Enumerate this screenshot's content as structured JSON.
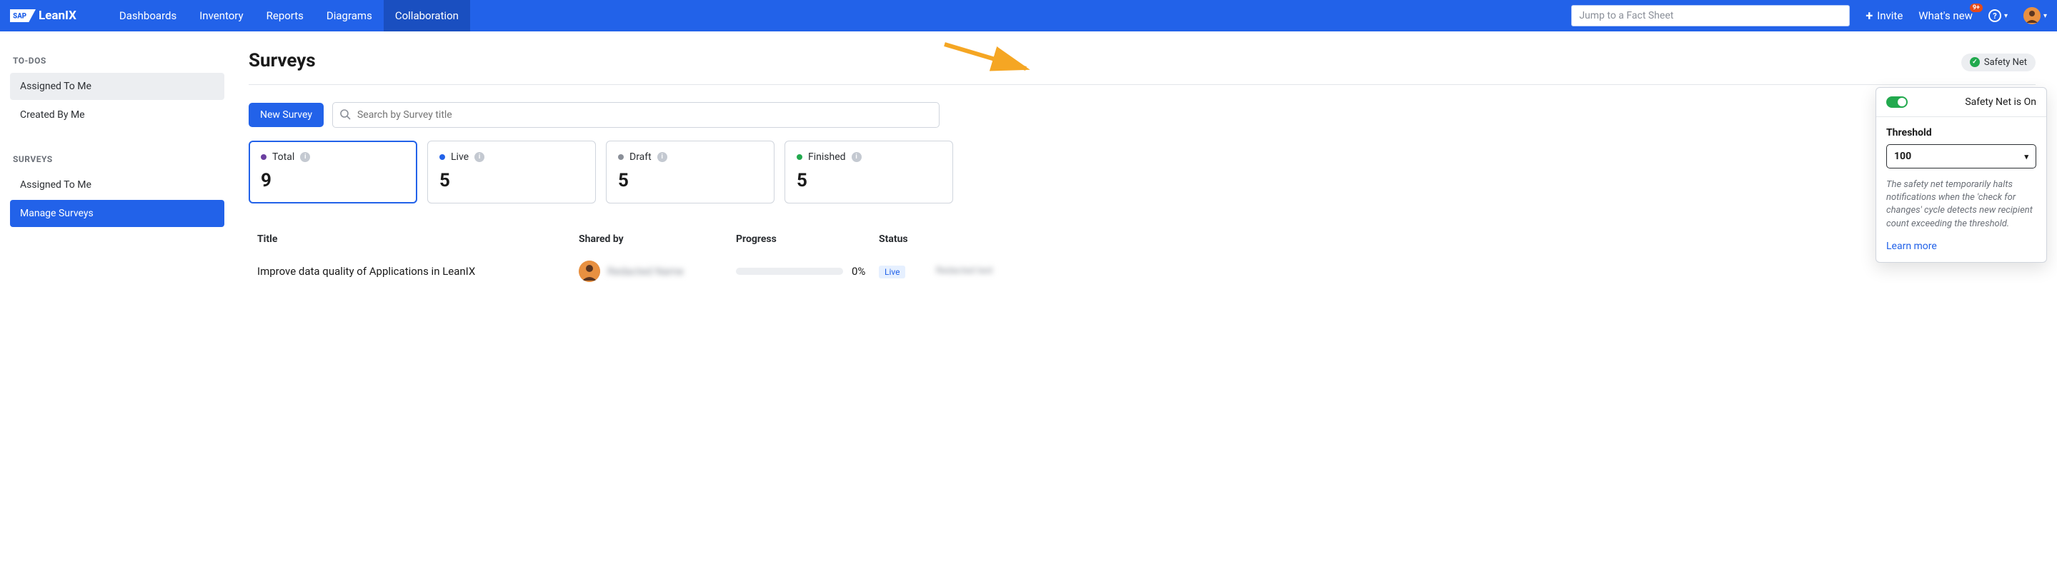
{
  "topbar": {
    "brand_prefix": "SAP",
    "brand_name": "LeanIX",
    "nav": [
      "Dashboards",
      "Inventory",
      "Reports",
      "Diagrams",
      "Collaboration"
    ],
    "active_nav_index": 4,
    "jump_placeholder": "Jump to a Fact Sheet",
    "invite": "Invite",
    "whats_new": "What's new",
    "whats_new_badge": "9+"
  },
  "sidebar": {
    "todos_header": "TO-DOS",
    "todos": [
      "Assigned To Me",
      "Created By Me"
    ],
    "surveys_header": "SURVEYS",
    "surveys": [
      "Assigned To Me",
      "Manage Surveys"
    ],
    "selected_todo_index": 0,
    "active_survey_index": 1
  },
  "page": {
    "title": "Surveys",
    "safety_chip": "Safety Net",
    "new_survey": "New Survey",
    "search_placeholder": "Search by Survey title"
  },
  "stats": [
    {
      "label": "Total",
      "value": "9",
      "dot": "#6b3fa0"
    },
    {
      "label": "Live",
      "value": "5",
      "dot": "#2262e9"
    },
    {
      "label": "Draft",
      "value": "5",
      "dot": "#8a8f98"
    },
    {
      "label": "Finished",
      "value": "5",
      "dot": "#22a94e"
    }
  ],
  "table": {
    "headers": {
      "title": "Title",
      "shared": "Shared by",
      "progress": "Progress",
      "status": "Status"
    },
    "rows": [
      {
        "title": "Improve data quality of Applications in LeanIX",
        "shared_by": "Redacted Name",
        "progress_pct": "0%",
        "status": "Live",
        "last_col": "Redacted text"
      }
    ]
  },
  "popover": {
    "status_text": "Safety Net is On",
    "threshold_label": "Threshold",
    "threshold_value": "100",
    "description": "The safety net temporarily halts notifications when the 'check for changes' cycle detects new recipient count exceeding the threshold.",
    "learn_more": "Learn more"
  }
}
